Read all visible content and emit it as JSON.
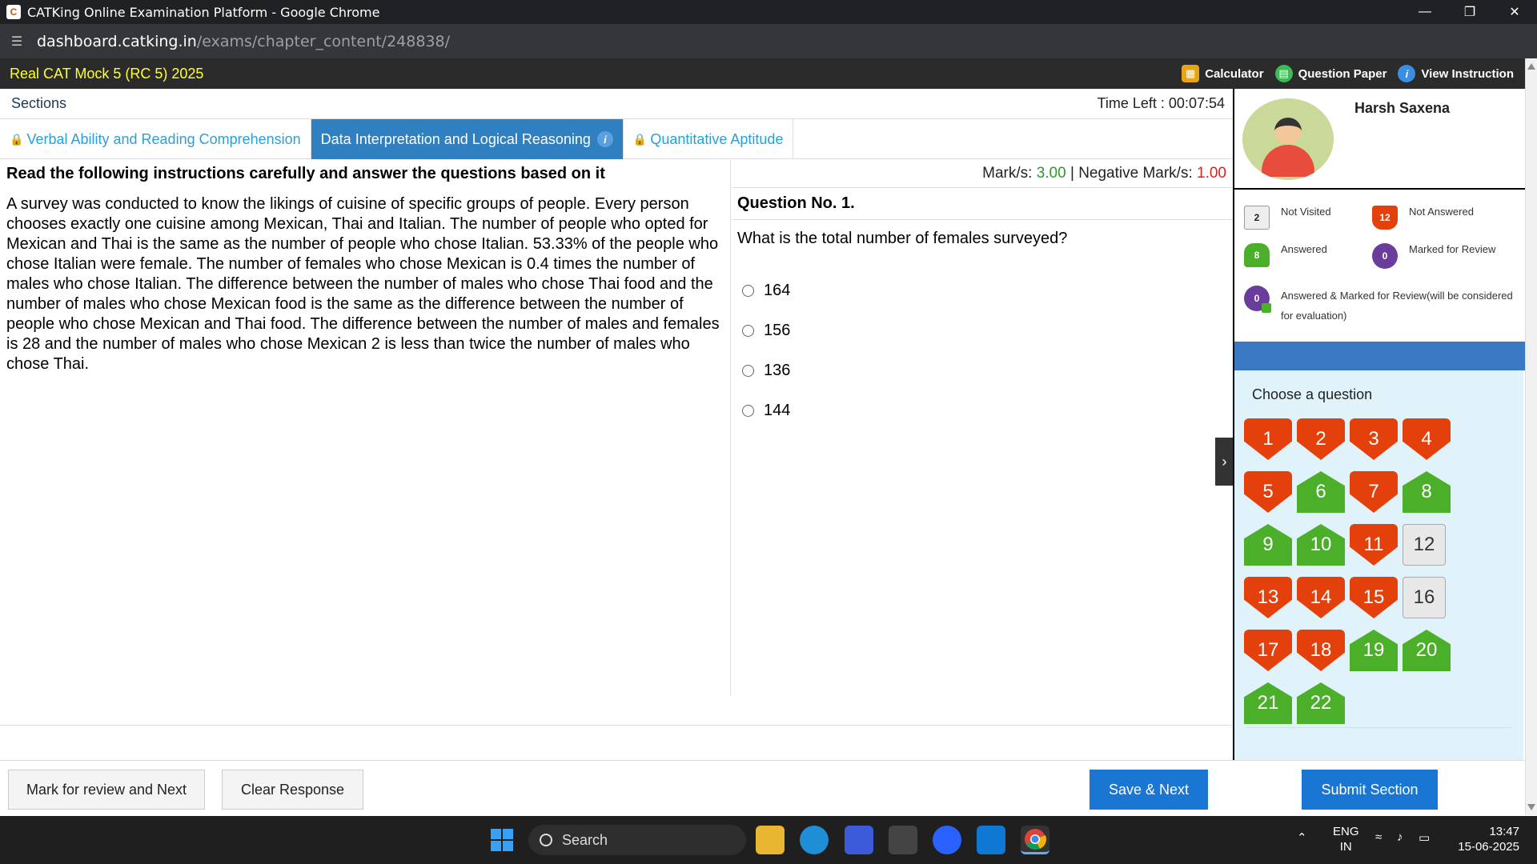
{
  "browser": {
    "window_title": "CATKing Online Examination Platform - Google Chrome",
    "url_host": "dashboard.catking.in",
    "url_path": "/exams/chapter_content/248838/"
  },
  "exam": {
    "title": "Real CAT Mock 5 (RC 5) 2025",
    "tools": {
      "calculator": "Calculator",
      "question_paper": "Question Paper",
      "view_instruction": "View Instruction"
    },
    "sections_label": "Sections",
    "time_left": "Time Left : 00:07:54",
    "tabs": [
      {
        "label": "Verbal Ability and Reading Comprehension",
        "locked": true,
        "active": false
      },
      {
        "label": "Data Interpretation and Logical Reasoning",
        "locked": false,
        "active": true
      },
      {
        "label": "Quantitative Aptitude",
        "locked": true,
        "active": false
      }
    ]
  },
  "passage": {
    "heading": "Read the following instructions carefully and answer the questions based on it",
    "text": "A survey was conducted to know the likings of cuisine of specific groups of people. Every person chooses exactly one cuisine among Mexican, Thai and Italian. The number of people who opted for Mexican and Thai is the same as the number of people who chose Italian. 53.33% of the people who chose Italian were female. The number of females who chose Mexican is 0.4 times the number of males who chose Italian. The difference between the number of males who chose Thai food and the number of males who chose Mexican food is the same as the difference between the number of people who chose Mexican and Thai food. The difference between the number of males and females is 28 and the number of males who chose Mexican 2 is less than twice the number of males who chose Thai."
  },
  "question": {
    "marks_label": "Mark/s:",
    "marks_value": "3.00",
    "separator": " | ",
    "negative_label": "Negative Mark/s:",
    "negative_value": "1.00",
    "number_label": "Question No. 1.",
    "text": "What is the total number of females surveyed?",
    "options": [
      "164",
      "156",
      "136",
      "144"
    ]
  },
  "actions": {
    "mark_review": "Mark for review and Next",
    "clear_response": "Clear Response",
    "save_next": "Save & Next",
    "submit_section": "Submit Section"
  },
  "candidate": {
    "name": "Harsh Saxena"
  },
  "legend": {
    "not_visited": {
      "count": "2",
      "label": "Not Visited"
    },
    "not_answered": {
      "count": "12",
      "label": "Not Answered"
    },
    "answered": {
      "count": "8",
      "label": "Answered"
    },
    "marked_for_review": {
      "count": "0",
      "label": "Marked for Review"
    },
    "answered_marked": {
      "count": "0",
      "label_line1": "Answered & Marked for Review(will be considered",
      "label_line2": "for evaluation)"
    }
  },
  "palette": {
    "title": "Choose a question",
    "questions": [
      {
        "n": "1",
        "status": "na"
      },
      {
        "n": "2",
        "status": "na"
      },
      {
        "n": "3",
        "status": "na"
      },
      {
        "n": "4",
        "status": "na"
      },
      {
        "n": "5",
        "status": "na"
      },
      {
        "n": "6",
        "status": "ans"
      },
      {
        "n": "7",
        "status": "na"
      },
      {
        "n": "8",
        "status": "ans"
      },
      {
        "n": "9",
        "status": "ans"
      },
      {
        "n": "10",
        "status": "ans"
      },
      {
        "n": "11",
        "status": "na"
      },
      {
        "n": "12",
        "status": "nv"
      },
      {
        "n": "13",
        "status": "na"
      },
      {
        "n": "14",
        "status": "na"
      },
      {
        "n": "15",
        "status": "na"
      },
      {
        "n": "16",
        "status": "nv"
      },
      {
        "n": "17",
        "status": "na"
      },
      {
        "n": "18",
        "status": "na"
      },
      {
        "n": "19",
        "status": "ans"
      },
      {
        "n": "20",
        "status": "ans"
      },
      {
        "n": "21",
        "status": "ans"
      },
      {
        "n": "22",
        "status": "ans"
      }
    ]
  },
  "taskbar": {
    "search_label": "Search",
    "lang_line1": "ENG",
    "lang_line2": "IN",
    "time": "13:47",
    "date": "15-06-2025"
  },
  "colors": {
    "accent_blue": "#1976d2",
    "not_answered": "#e4400c",
    "answered": "#4caf2a",
    "marked_review": "#6a3d9a",
    "header_title": "#ffff33"
  }
}
